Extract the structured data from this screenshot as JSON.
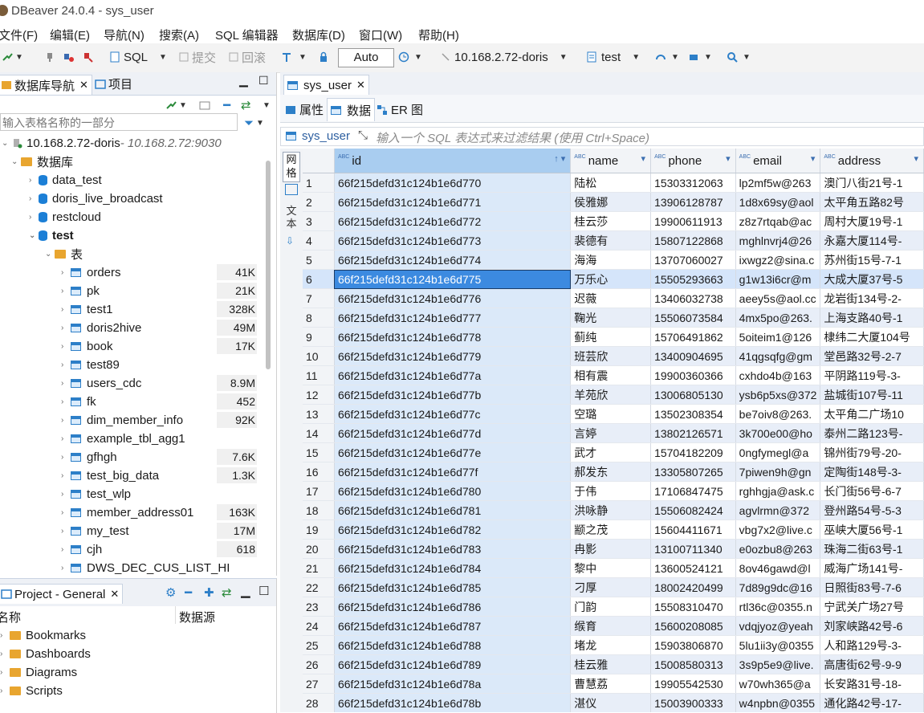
{
  "window": {
    "title": "DBeaver 24.0.4 - sys_user"
  },
  "menu": [
    "文件(F)",
    "编辑(E)",
    "导航(N)",
    "搜索(A)",
    "SQL 编辑器",
    "数据库(D)",
    "窗口(W)",
    "帮助(H)"
  ],
  "toolbar": {
    "sql_label": "SQL",
    "commit_label": "提交",
    "rollback_label": "回滚",
    "auto_label": "Auto",
    "connection_label": "10.168.2.72-doris",
    "database_label": "test"
  },
  "left_panel": {
    "tab_navigator": "数据库导航",
    "tab_projects": "项目",
    "filter_placeholder": "输入表格名称的一部分",
    "connection_name": "10.168.2.72-doris",
    "connection_host": " - 10.168.2.72:9030",
    "databases_folder": "数据库",
    "databases": [
      "data_test",
      "doris_live_broadcast",
      "restcloud"
    ],
    "active_db": "test",
    "tables_folder": "表",
    "tables": [
      {
        "name": "orders",
        "size": "41K"
      },
      {
        "name": "pk",
        "size": "21K"
      },
      {
        "name": "test1",
        "size": "328K"
      },
      {
        "name": "doris2hive",
        "size": "49M"
      },
      {
        "name": "book",
        "size": "17K"
      },
      {
        "name": "test89",
        "size": ""
      },
      {
        "name": "users_cdc",
        "size": "8.9M"
      },
      {
        "name": "fk",
        "size": "452"
      },
      {
        "name": "dim_member_info",
        "size": "92K"
      },
      {
        "name": "example_tbl_agg1",
        "size": ""
      },
      {
        "name": "gfhgh",
        "size": "7.6K"
      },
      {
        "name": "test_big_data",
        "size": "1.3K"
      },
      {
        "name": "test_wlp",
        "size": ""
      },
      {
        "name": "member_address01",
        "size": "163K"
      },
      {
        "name": "my_test",
        "size": "17M"
      },
      {
        "name": "cjh",
        "size": "618"
      },
      {
        "name": "DWS_DEC_CUS_LIST_HI",
        "size": ""
      }
    ]
  },
  "project_panel": {
    "title": "Project - General",
    "col_name": "名称",
    "col_source": "数据源",
    "items": [
      "Bookmarks",
      "Dashboards",
      "Diagrams",
      "Scripts"
    ]
  },
  "editor": {
    "tab_label": "sys_user",
    "subtabs": [
      "属性",
      "数据",
      "ER 图"
    ],
    "filter_table": "sys_user",
    "filter_placeholder": "输入一个 SQL 表达式来过滤结果 (使用 Ctrl+Space)",
    "side_label_grid": "网格",
    "side_label_text": "文本"
  },
  "grid": {
    "columns": [
      "id",
      "name",
      "phone",
      "email",
      "address"
    ],
    "selected_row": 6,
    "rows": [
      [
        "1",
        "66f215defd31c124b1e6d770",
        "陆松",
        "15303312063",
        "lp2mf5w@263",
        "澳门八街21号-1"
      ],
      [
        "2",
        "66f215defd31c124b1e6d771",
        "侯雅娜",
        "13906128787",
        "1d8x69sy@aol",
        "太平角五路82号"
      ],
      [
        "3",
        "66f215defd31c124b1e6d772",
        "桂云莎",
        "19900611913",
        "z8z7rtqab@ac",
        "周村大厦19号-1"
      ],
      [
        "4",
        "66f215defd31c124b1e6d773",
        "裴德有",
        "15807122868",
        "mghlnvrj4@26",
        "永嘉大厦114号-"
      ],
      [
        "5",
        "66f215defd31c124b1e6d774",
        "海海",
        "13707060027",
        "ixwgz2@sina.c",
        "苏州街15号-7-1"
      ],
      [
        "6",
        "66f215defd31c124b1e6d775",
        "万乐心",
        "15505293663",
        "g1w13i6cr@m",
        "大成大厦37号-5"
      ],
      [
        "7",
        "66f215defd31c124b1e6d776",
        "迟薇",
        "13406032738",
        "aeey5s@aol.cc",
        "龙岩街134号-2-"
      ],
      [
        "8",
        "66f215defd31c124b1e6d777",
        "鞠光",
        "15506073584",
        "4mx5po@263.",
        "上海支路40号-1"
      ],
      [
        "9",
        "66f215defd31c124b1e6d778",
        "蓟纯",
        "15706491862",
        "5oiteim1@126",
        "棣纬二大厦104号"
      ],
      [
        "10",
        "66f215defd31c124b1e6d779",
        "班芸欣",
        "13400904695",
        "41qgsqfg@gm",
        "堂邑路32号-2-7"
      ],
      [
        "11",
        "66f215defd31c124b1e6d77a",
        "相有震",
        "19900360366",
        "cxhdo4b@163",
        "平阴路119号-3-"
      ],
      [
        "12",
        "66f215defd31c124b1e6d77b",
        "羊苑欣",
        "13006805130",
        "ysb6p5xs@372",
        "盐城街107号-11"
      ],
      [
        "13",
        "66f215defd31c124b1e6d77c",
        "空璐",
        "13502308354",
        "be7oiv8@263.",
        "太平角二广场10"
      ],
      [
        "14",
        "66f215defd31c124b1e6d77d",
        "言婷",
        "13802126571",
        "3k700e00@ho",
        "泰州二路123号-"
      ],
      [
        "15",
        "66f215defd31c124b1e6d77e",
        "武才",
        "15704182209",
        "0ngfymegl@a",
        "锦州街79号-20-"
      ],
      [
        "16",
        "66f215defd31c124b1e6d77f",
        "郝发东",
        "13305807265",
        "7piwen9h@gn",
        "定陶街148号-3-"
      ],
      [
        "17",
        "66f215defd31c124b1e6d780",
        "于伟",
        "17106847475",
        "rghhgja@ask.c",
        "长门街56号-6-7"
      ],
      [
        "18",
        "66f215defd31c124b1e6d781",
        "洪咏静",
        "15506082424",
        "agvlrmn@372",
        "登州路54号-5-3"
      ],
      [
        "19",
        "66f215defd31c124b1e6d782",
        "颛之茂",
        "15604411671",
        "vbg7x2@live.c",
        "巫峡大厦56号-1"
      ],
      [
        "20",
        "66f215defd31c124b1e6d783",
        "冉影",
        "13100711340",
        "e0ozbu8@263",
        "珠海二街63号-1"
      ],
      [
        "21",
        "66f215defd31c124b1e6d784",
        "黎中",
        "13600524121",
        "8ov46gawd@l",
        "威海广场141号-"
      ],
      [
        "22",
        "66f215defd31c124b1e6d785",
        "刁厚",
        "18002420499",
        "7d89g9dc@16",
        "日照街83号-7-6"
      ],
      [
        "23",
        "66f215defd31c124b1e6d786",
        "门韵",
        "15508310470",
        "rtl36c@0355.n",
        "宁武关广场27号"
      ],
      [
        "24",
        "66f215defd31c124b1e6d787",
        "缑育",
        "15600208085",
        "vdqjyoz@yeah",
        "刘家峡路42号-6"
      ],
      [
        "25",
        "66f215defd31c124b1e6d788",
        "堵龙",
        "15903806870",
        "5lu1ii3y@0355",
        "人和路129号-3-"
      ],
      [
        "26",
        "66f215defd31c124b1e6d789",
        "桂云雅",
        "15008580313",
        "3s9p5e9@live.",
        "高唐街62号-9-9"
      ],
      [
        "27",
        "66f215defd31c124b1e6d78a",
        "曹慧荔",
        "19905542530",
        "w70wh365@a",
        "长安路31号-18-"
      ],
      [
        "28",
        "66f215defd31c124b1e6d78b",
        "湛仪",
        "15003900333",
        "w4npbn@0355",
        "通化路42号-17-"
      ]
    ]
  }
}
